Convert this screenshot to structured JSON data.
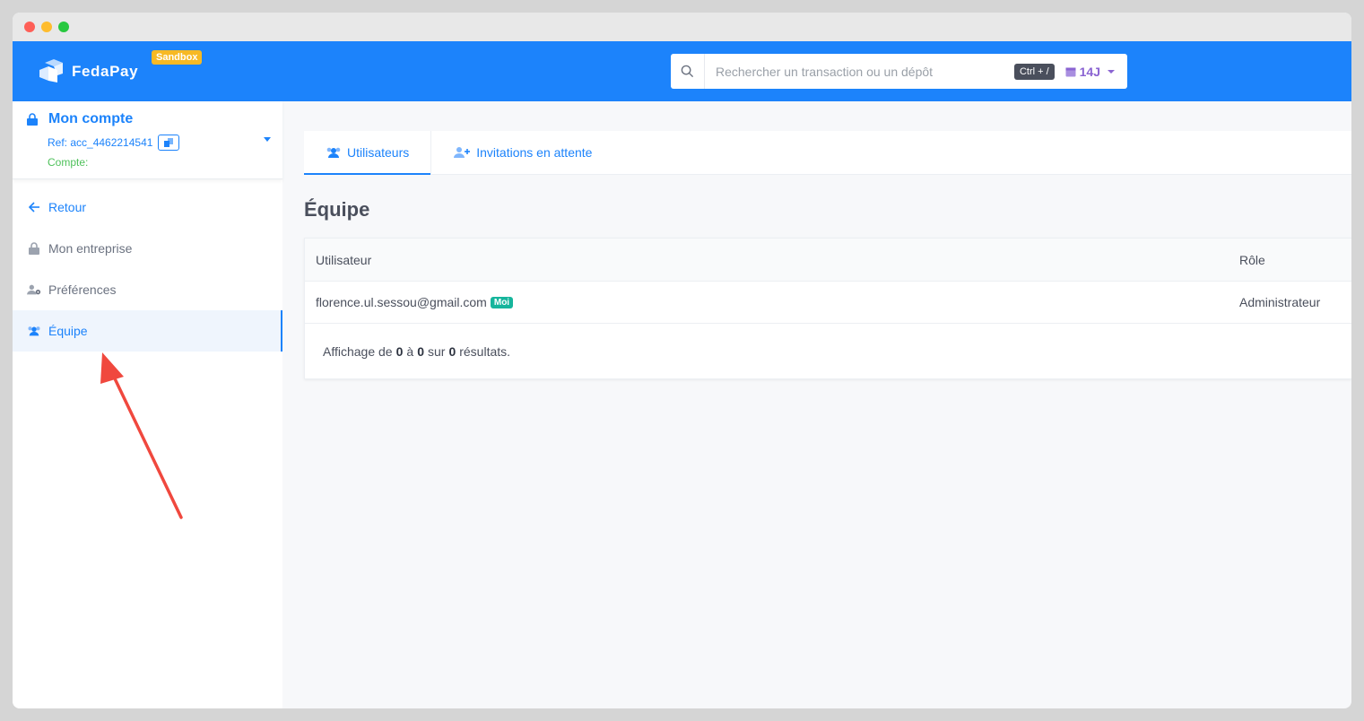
{
  "window": {
    "controls": [
      "close",
      "minimize",
      "maximize"
    ]
  },
  "topbar": {
    "brand": "FedaPay",
    "env_badge": "Sandbox",
    "search_placeholder": "Rechercher un transaction ou un dépôt",
    "search_shortcut": "Ctrl + /",
    "period": "14J",
    "bg_color": "#1c83fb"
  },
  "sidebar": {
    "account_title": "Mon compte",
    "account_ref": "Ref: acc_4462214541",
    "account_type_label": "Compte:",
    "items": [
      {
        "label": "Retour",
        "icon": "arrow-left-icon"
      },
      {
        "label": "Mon entreprise",
        "icon": "lock-icon"
      },
      {
        "label": "Préférences",
        "icon": "user-gear-icon"
      },
      {
        "label": "Équipe",
        "icon": "users-icon",
        "active": true
      }
    ]
  },
  "main": {
    "tabs": [
      {
        "label": "Utilisateurs",
        "active": true
      },
      {
        "label": "Invitations en attente",
        "active": false
      }
    ],
    "title": "Équipe",
    "table": {
      "headers": {
        "user": "Utilisateur",
        "role": "Rôle"
      },
      "rows": [
        {
          "email": "florence.ul.sessou@gmail.com",
          "badge": "Moi",
          "role": "Administrateur"
        }
      ]
    },
    "pagination": {
      "prefix": "Affichage de",
      "from": "0",
      "to_word": "à",
      "to": "0",
      "of_word": "sur",
      "total": "0",
      "suffix": "résultats."
    }
  }
}
